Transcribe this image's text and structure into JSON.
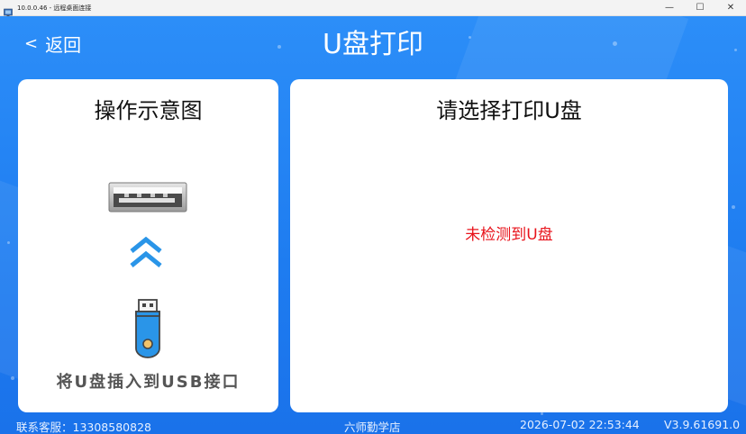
{
  "window": {
    "title": "10.0.0.46 - 远程桌面连接",
    "controls": {
      "minimize": "—",
      "maximize": "☐",
      "close": "✕"
    }
  },
  "header": {
    "back_chevron": "<",
    "back_label": "返回",
    "title": "U盘打印"
  },
  "left_panel": {
    "title": "操作示意图",
    "caption": "将U盘插入到USB接口"
  },
  "right_panel": {
    "title": "请选择打印U盘",
    "status": "未检测到U盘"
  },
  "footer": {
    "service": "联系客服：13308580828",
    "shop": "六师勤学店",
    "datetime": "2026-07-02 22:53:44",
    "version": "V3.9.61691.0"
  },
  "colors": {
    "background": "#1e7cf0",
    "status_text": "#e8131b",
    "arrow": "#2a95e8"
  },
  "icons": [
    "app-icon",
    "usb-port-icon",
    "double-chevron-up-icon",
    "usb-stick-icon"
  ]
}
